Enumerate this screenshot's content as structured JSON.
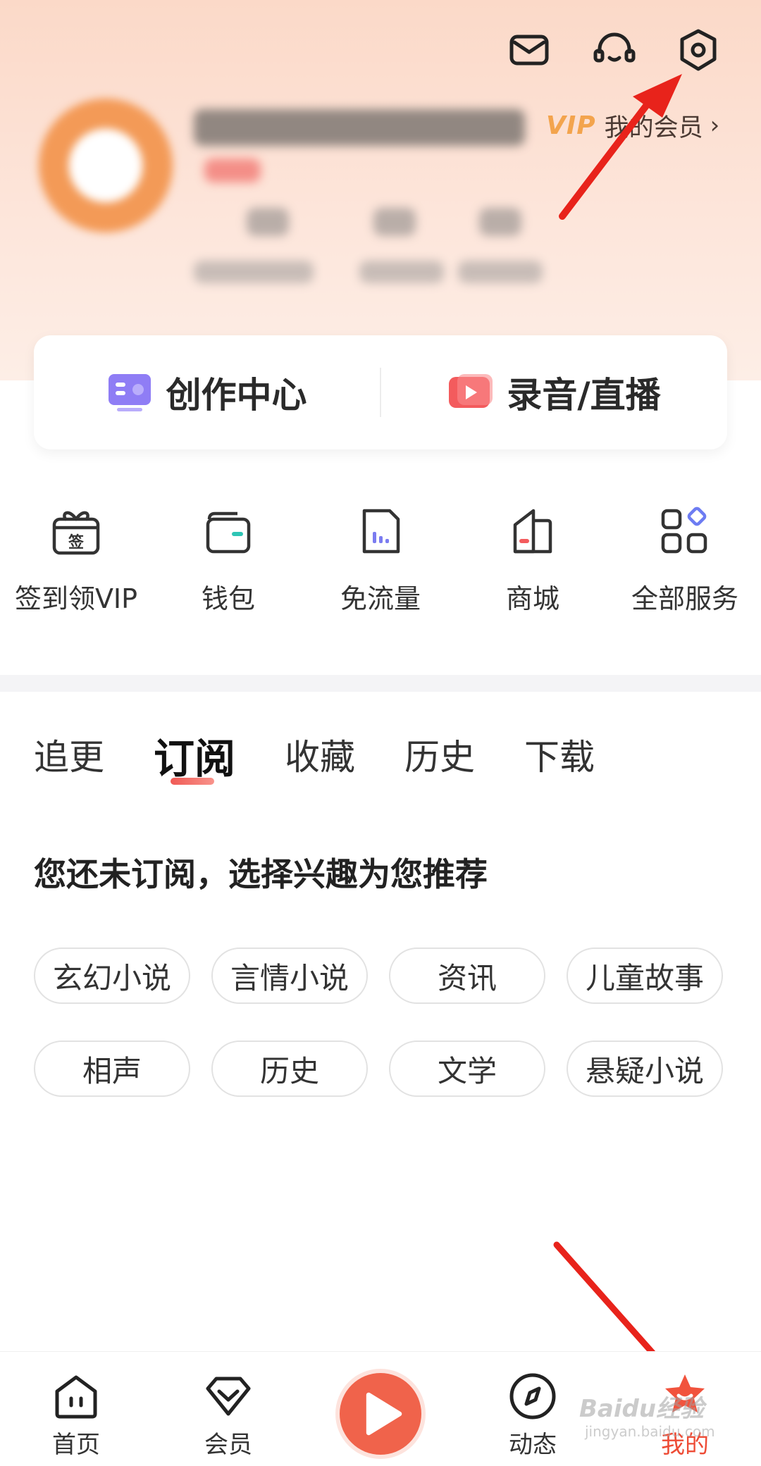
{
  "header": {
    "vip_logo": "VIP",
    "vip_text": "我的会员",
    "vip_chevron": "›",
    "icons": [
      "mail-icon",
      "customer-service-icon",
      "settings-icon"
    ]
  },
  "creation_card": {
    "left_label": "创作中心",
    "right_label": "录音/直播"
  },
  "shortcuts": [
    {
      "label": "签到领VIP",
      "icon": "sign-in-gift-icon",
      "icon_char": "签"
    },
    {
      "label": "钱包",
      "icon": "wallet-icon"
    },
    {
      "label": "免流量",
      "icon": "free-data-icon"
    },
    {
      "label": "商城",
      "icon": "mall-icon"
    },
    {
      "label": "全部服务",
      "icon": "all-services-icon"
    }
  ],
  "tabs": [
    {
      "label": "追更",
      "active": false
    },
    {
      "label": "订阅",
      "active": true
    },
    {
      "label": "收藏",
      "active": false
    },
    {
      "label": "历史",
      "active": false
    },
    {
      "label": "下载",
      "active": false
    }
  ],
  "empty_state": {
    "title": "您还未订阅，选择兴趣为您推荐"
  },
  "interest_tags": [
    "玄幻小说",
    "言情小说",
    "资讯",
    "儿童故事",
    "相声",
    "历史",
    "文学",
    "悬疑小说"
  ],
  "bottom_nav": [
    {
      "label": "首页",
      "icon": "home-icon",
      "active": false
    },
    {
      "label": "会员",
      "icon": "vip-diamond-icon",
      "active": false
    },
    {
      "label": "",
      "icon": "play-icon",
      "active": false
    },
    {
      "label": "动态",
      "icon": "compass-icon",
      "active": false
    },
    {
      "label": "我的",
      "icon": "mine-star-icon",
      "active": true
    }
  ],
  "watermark": {
    "text": "Baidu经验",
    "sub": "jingyan.baidu.com"
  },
  "colors": {
    "accent": "#f0634b",
    "active_nav": "#ee4c36",
    "vip_gold": "#f3a44d",
    "annotation_arrow": "#e8231b"
  }
}
